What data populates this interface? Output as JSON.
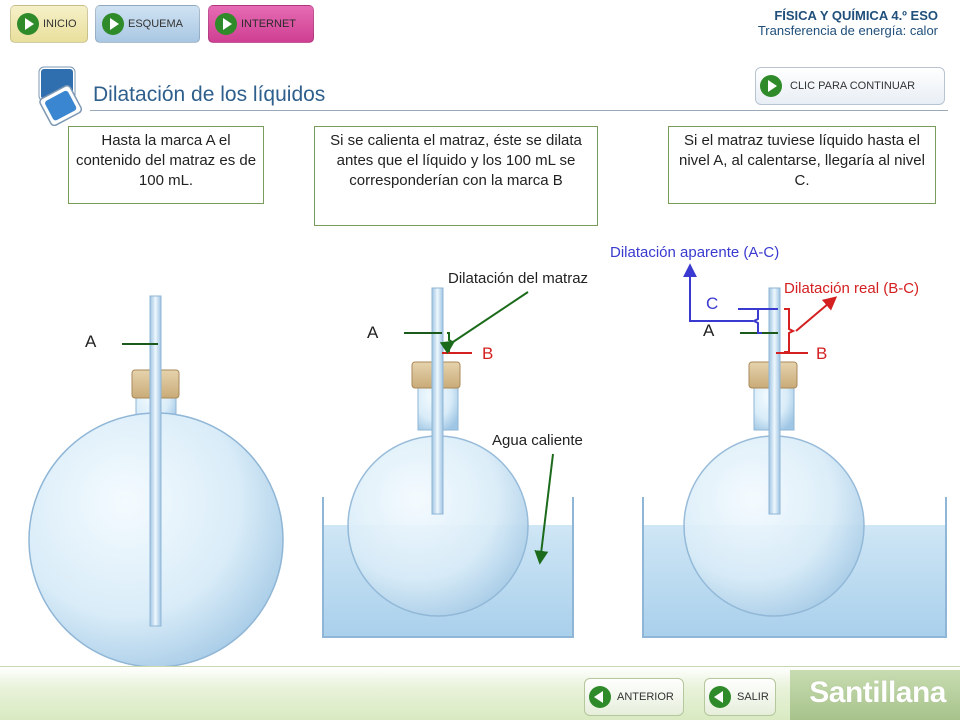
{
  "nav": {
    "inicio": "INICIO",
    "esquema": "ESQUEMA",
    "internet": "INTERNET"
  },
  "course": {
    "line1": "FÍSICA Y QUÍMICA 4.º ESO",
    "line2": "Transferencia de energía: calor"
  },
  "title": "Dilatación de los líquidos",
  "continue_label": "CLIC PARA CONTINUAR",
  "boxes": {
    "box1": "Hasta la marca A el contenido del matraz es de 100 mL.",
    "box2": "Si se calienta el matraz, éste se dilata antes que el líquido y los 100 mL se corresponderían con la marca B",
    "box3": "Si el matraz tuviese líquido hasta el nivel A, al calentarse, llegaría al nivel C."
  },
  "diagram": {
    "flask1_mark_a": "A",
    "flask2_mark_a": "A",
    "flask2_mark_b": "B",
    "flask2_label_dilatacion_matraz": "Dilatación del matraz",
    "flask2_label_agua": "Agua caliente",
    "flask3_mark_c": "C",
    "flask3_mark_a": "A",
    "flask3_mark_b": "B",
    "flask3_label_aparente": "Dilatación aparente (A-C)",
    "flask3_label_real": "Dilatación real (B-C)"
  },
  "footer": {
    "anterior": "ANTERIOR",
    "salir": "SALIR",
    "brand": "Santillana"
  },
  "colors": {
    "accent_green": "#2f8a2a",
    "title_blue": "#2f5f8c",
    "dilatacion_real_red": "#d42020",
    "dilatacion_aparente_blue": "#3a3ad0",
    "marker_dark_green": "#1c5a1c"
  }
}
